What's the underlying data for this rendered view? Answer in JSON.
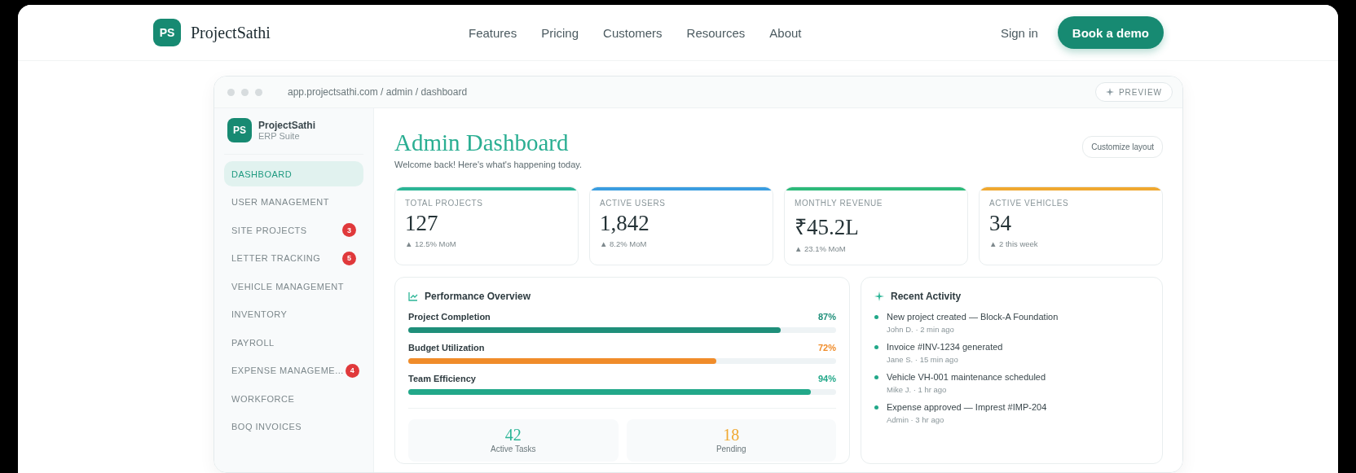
{
  "nav": {
    "logo_mark": "PS",
    "brand": "ProjectSathi",
    "links": [
      "Features",
      "Pricing",
      "Customers",
      "Resources",
      "About"
    ],
    "sign_in": "Sign in",
    "cta": "Book a demo"
  },
  "browser": {
    "url": "app.projectsathi.com / admin / dashboard",
    "preview": "PREVIEW"
  },
  "sidebar": {
    "logo_mark": "PS",
    "brand": "ProjectSathi",
    "subtitle": "ERP Suite",
    "items": [
      {
        "label": "DASHBOARD",
        "selected": true
      },
      {
        "label": "USER MANAGEMENT",
        "selected": false
      },
      {
        "label": "SITE PROJECTS",
        "selected": false,
        "badge": "3"
      },
      {
        "label": "LETTER TRACKING",
        "selected": false,
        "badge": "5"
      },
      {
        "label": "VEHICLE MANAGEMENT",
        "selected": false
      },
      {
        "label": "INVENTORY",
        "selected": false
      },
      {
        "label": "PAYROLL",
        "selected": false
      },
      {
        "label": "EXPENSE MANAGEME...",
        "selected": false,
        "badge": "4"
      },
      {
        "label": "WORKFORCE",
        "selected": false
      },
      {
        "label": "BOQ INVOICES",
        "selected": false
      }
    ]
  },
  "main": {
    "title": "Admin Dashboard",
    "subtitle": "Welcome back! Here's what's happening today.",
    "customize": "Customize layout",
    "stats": [
      {
        "label": "TOTAL PROJECTS",
        "value": "127",
        "change": "▲ 12.5% MoM",
        "color": "#2bb596"
      },
      {
        "label": "ACTIVE USERS",
        "value": "1,842",
        "change": "▲ 8.2% MoM",
        "color": "#3a9de0"
      },
      {
        "label": "MONTHLY REVENUE",
        "value": "₹45.2L",
        "change": "▲ 23.1% MoM",
        "color": "#2dba7a"
      },
      {
        "label": "ACTIVE VEHICLES",
        "value": "34",
        "change": "▲ 2 this week",
        "color": "#f0a830"
      }
    ],
    "performance": {
      "title": "Performance Overview",
      "bars": [
        {
          "label": "Project Completion",
          "reading": "87%",
          "level": 0.87,
          "color": "#1f8f7a"
        },
        {
          "label": "Budget Utilization",
          "reading": "72%",
          "level": 0.72,
          "color": "#f08c2a"
        },
        {
          "label": "Team Efficiency",
          "reading": "94%",
          "level": 0.94,
          "color": "#22a889"
        }
      ],
      "tiles": [
        {
          "value": "42",
          "label": "Active Tasks",
          "color": "#2bb596"
        },
        {
          "value": "18",
          "label": "Pending",
          "color": "#f0a830"
        }
      ]
    },
    "activity": {
      "title": "Recent Activity",
      "items": [
        {
          "text": "New project created — Block-A Foundation",
          "meta": "John D. · 2 min ago"
        },
        {
          "text": "Invoice #INV-1234 generated",
          "meta": "Jane S. · 15 min ago"
        },
        {
          "text": "Vehicle VH-001 maintenance scheduled",
          "meta": "Mike J. · 1 hr ago"
        },
        {
          "text": "Expense approved — Imprest #IMP-204",
          "meta": "Admin · 3 hr ago"
        }
      ]
    }
  }
}
